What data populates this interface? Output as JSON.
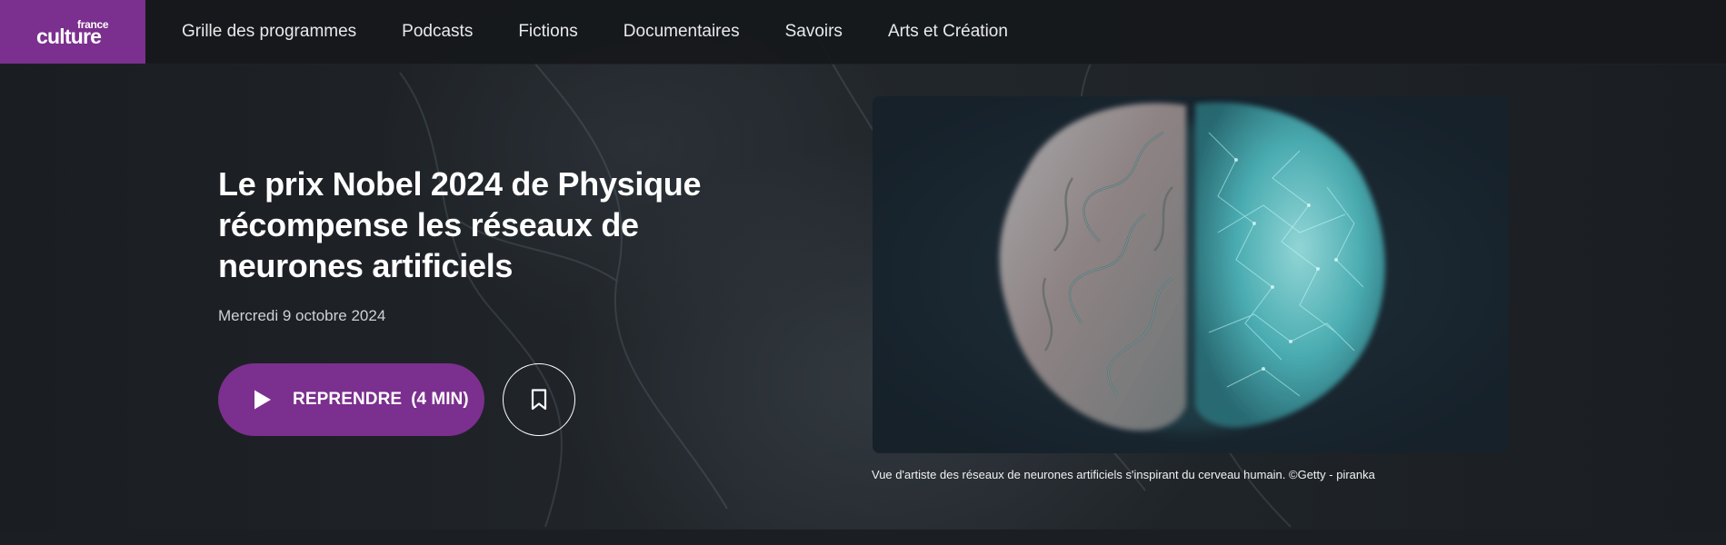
{
  "brand": {
    "logo_small": "france",
    "logo_big": "culture",
    "color": "#7b2f8e"
  },
  "nav": {
    "items": [
      "Grille des programmes",
      "Podcasts",
      "Fictions",
      "Documentaires",
      "Savoirs",
      "Arts et Création"
    ]
  },
  "article": {
    "title": "Le prix Nobel 2024 de Physique récompense les réseaux de neurones artificiels",
    "date": "Mercredi 9 octobre 2024",
    "resume_label": "REPRENDRE",
    "duration": "(4 MIN)",
    "image_caption": "Vue d'artiste des réseaux de neurones artificiels s'inspirant du cerveau humain. ©Getty - piranka"
  },
  "icons": {
    "play": "play-icon",
    "bookmark": "bookmark-icon"
  }
}
